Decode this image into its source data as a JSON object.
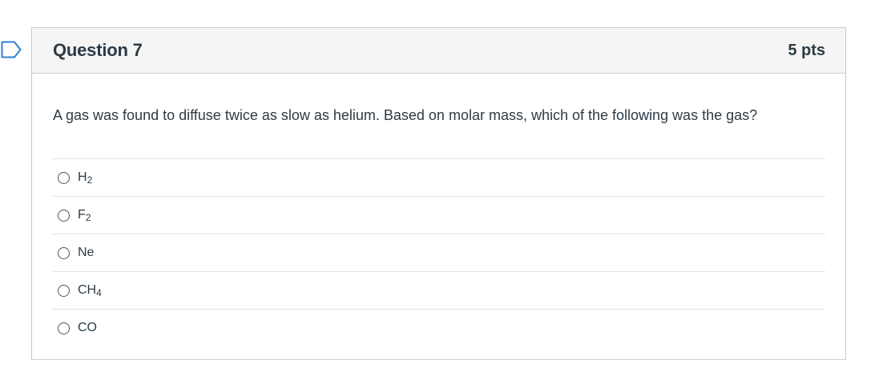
{
  "question": {
    "title": "Question 7",
    "points": "5 pts",
    "text": "A gas was found to diffuse twice as slow as helium. Based on molar mass, which of the following was the gas?",
    "flag_icon": "bookmark-flag-icon",
    "answers": [
      {
        "base": "H",
        "sub": "2"
      },
      {
        "base": "F",
        "sub": "2"
      },
      {
        "base": "Ne",
        "sub": ""
      },
      {
        "base": "CH",
        "sub": "4"
      },
      {
        "base": "CO",
        "sub": ""
      }
    ]
  },
  "colors": {
    "flag_blue": "#2d7fd3",
    "text": "#2d3b45",
    "border": "#c7cdd1",
    "header_bg": "#f5f5f5"
  }
}
